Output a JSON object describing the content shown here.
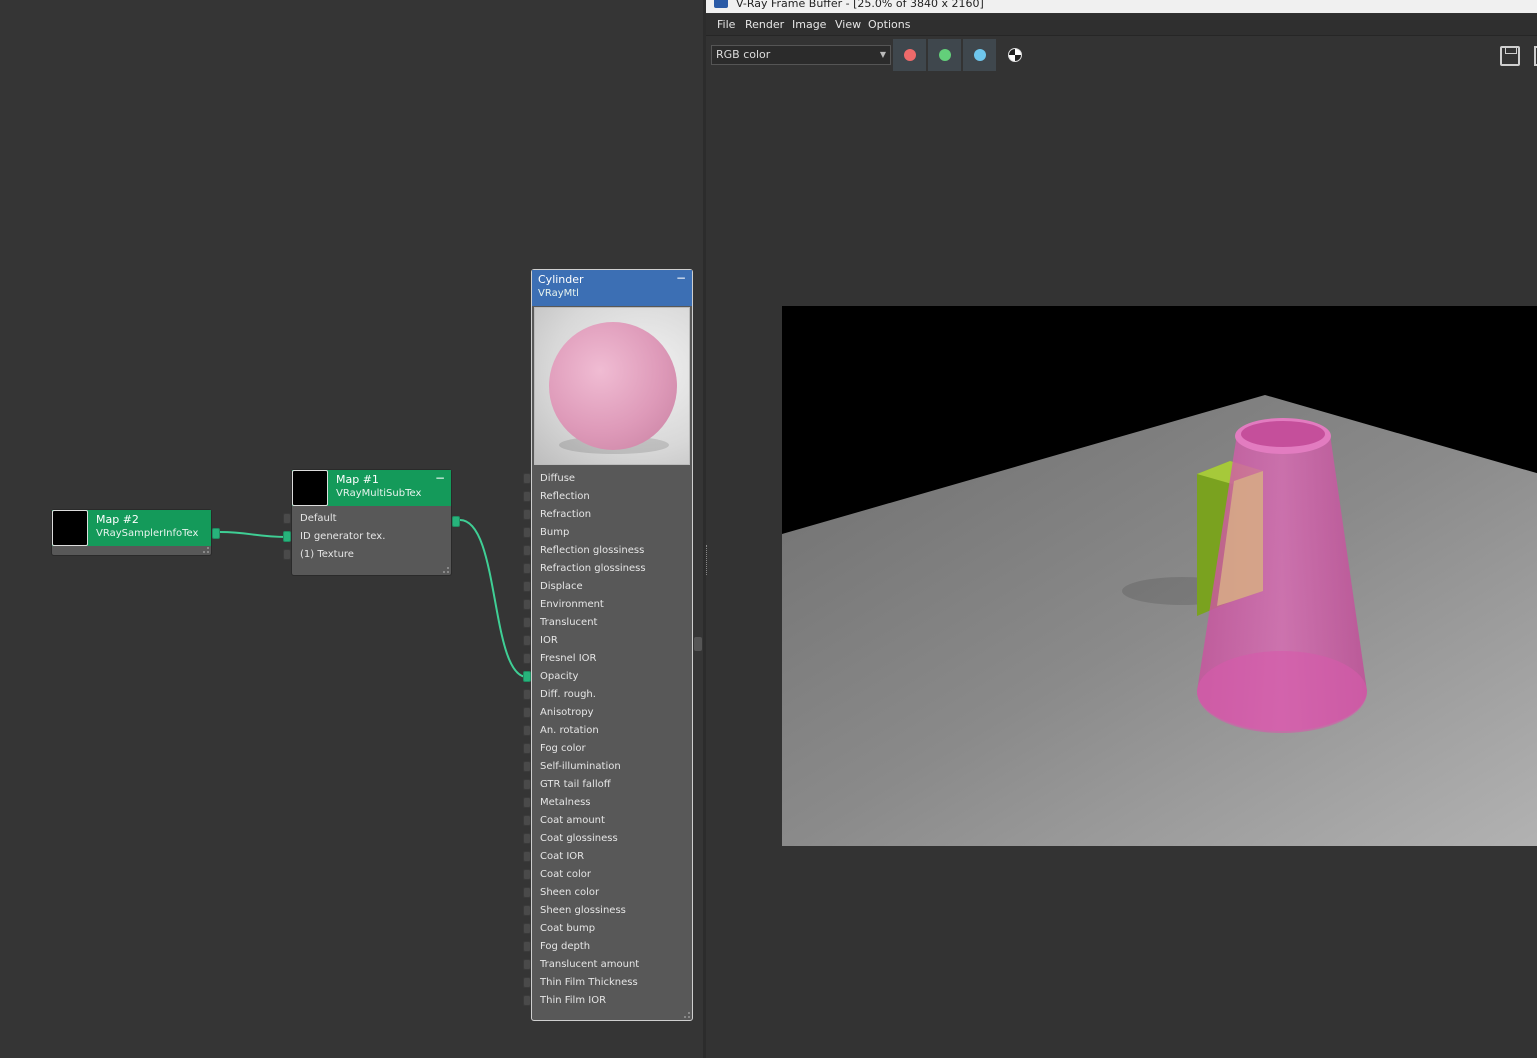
{
  "frame_buffer": {
    "title": "V-Ray Frame Buffer - [25.0% of 3840 x 2160]",
    "menu": [
      "File",
      "Render",
      "Image",
      "View",
      "Options"
    ],
    "channel_select_value": "RGB color",
    "channel_buttons": [
      {
        "name": "red",
        "color": "#ef6a6a"
      },
      {
        "name": "green",
        "color": "#63cf7a"
      },
      {
        "name": "blue",
        "color": "#6ec6ec"
      }
    ]
  },
  "nodes": {
    "map2": {
      "title": "Map #2",
      "subtitle": "VRaySamplerInfoTex"
    },
    "map1": {
      "title": "Map #1",
      "subtitle": "VRayMultiSubTex",
      "collapse": "−",
      "slots": [
        "Default",
        "ID generator tex.",
        "(1) Texture"
      ]
    },
    "cylinder": {
      "title": "Cylinder",
      "subtitle": "VRayMtl",
      "collapse": "−",
      "slots": [
        "Diffuse",
        "Reflection",
        "Refraction",
        "Bump",
        "Reflection glossiness",
        "Refraction glossiness",
        "Displace",
        "Environment",
        "Translucent",
        "IOR",
        "Fresnel IOR",
        "Opacity",
        "Diff. rough.",
        "Anisotropy",
        "An. rotation",
        "Fog color",
        "Self-illumination",
        "GTR tail falloff",
        "Metalness",
        "Coat amount",
        "Coat glossiness",
        "Coat IOR",
        "Coat color",
        "Sheen color",
        "Sheen glossiness",
        "Coat bump",
        "Fog depth",
        "Translucent amount",
        "Thin Film Thickness",
        "Thin Film IOR"
      ]
    }
  },
  "colors": {
    "node_header_green": "#149a5a",
    "node_header_blue": "#3c6fb4",
    "wire": "#3fcf95",
    "cylinder_pink": "#d45aa8",
    "box_green": "#8fb42a",
    "box_tan": "#d6a887"
  }
}
